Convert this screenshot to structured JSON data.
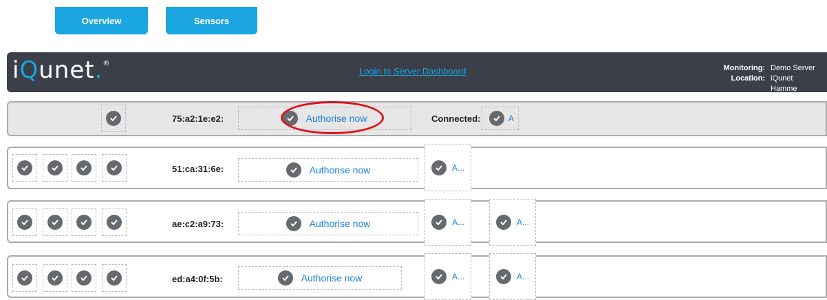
{
  "tabs": {
    "overview": "Overview",
    "sensors": "Sensors"
  },
  "header": {
    "logo_i": "i",
    "logo_q": "Q",
    "logo_rest": "unet",
    "logo_dot": ".",
    "logo_reg": "®",
    "login_link": "Login to Server Dashboard",
    "monitoring_label": "Monitoring:",
    "monitoring_value": "Demo Server",
    "location_label": "Location:",
    "location_value": "iQunet Hamme"
  },
  "rows": [
    {
      "mac": "75:a2:1e:e2:",
      "auth": "Authorise now",
      "connected_label": "Connected:",
      "connected_auth": "A"
    },
    {
      "mac": "51:ca:31:6e:",
      "auth": "Authorise now",
      "mini": "A..."
    },
    {
      "mac": "ae:c2:a9:73:",
      "auth": "Authorise now",
      "mini": "A...",
      "mini2": "A..."
    },
    {
      "mac": "ed:a4:0f:5b:",
      "auth": "Authorise now",
      "mini": "A...",
      "mini2": "A..."
    }
  ],
  "colors": {
    "accent": "#1aa6e0",
    "header_bg": "#3a3f4a",
    "link": "#1a7fe0",
    "annotation": "#e0101a"
  },
  "icons": {
    "shield": "shield-check-icon"
  }
}
